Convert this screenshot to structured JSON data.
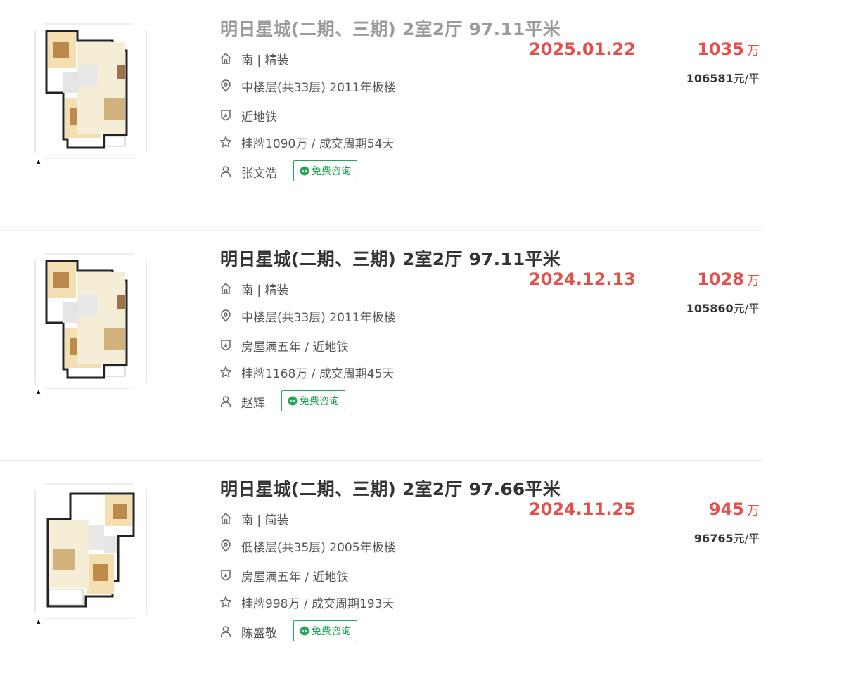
{
  "listings": [
    {
      "title": "明日星城(二期、三期) 2室2厅 97.11平米",
      "visited": true,
      "orientation": "南 | 精装",
      "floor": "中楼层(共33层) 2011年板楼",
      "tags": "近地铁",
      "listing_info": "挂牌1090万 / 成交周期54天",
      "agent": "张文浩",
      "deal_date": "2025.01.22",
      "total_price": "1035",
      "total_unit": "万",
      "unit_price": "106581",
      "unit_price_suffix": "元/平",
      "consult_label": "免费咨询"
    },
    {
      "title": "明日星城(二期、三期) 2室2厅 97.11平米",
      "visited": false,
      "orientation": "南 | 精装",
      "floor": "中楼层(共33层) 2011年板楼",
      "tags": "房屋满五年 / 近地铁",
      "listing_info": "挂牌1168万 / 成交周期45天",
      "agent": "赵辉",
      "deal_date": "2024.12.13",
      "total_price": "1028",
      "total_unit": "万",
      "unit_price": "105860",
      "unit_price_suffix": "元/平",
      "consult_label": "免费咨询"
    },
    {
      "title": "明日星城(二期、三期) 2室2厅 97.66平米",
      "visited": false,
      "orientation": "南 | 简装",
      "floor": "低楼层(共35层) 2005年板楼",
      "tags": "房屋满五年 / 近地铁",
      "listing_info": "挂牌998万 / 成交周期193天",
      "agent": "陈盛敬",
      "deal_date": "2024.11.25",
      "total_price": "945",
      "total_unit": "万",
      "unit_price": "96765",
      "unit_price_suffix": "元/平",
      "consult_label": "免费咨询"
    }
  ],
  "icons": {
    "orientation": "house-icon",
    "floor": "location-pin-icon",
    "tags": "shield-badge-icon",
    "listing_info": "star-icon",
    "agent": "person-icon",
    "consult": "wechat-icon"
  },
  "colors": {
    "price_red": "#e1504b",
    "consult_green": "#26a65b",
    "title_dark": "#333333",
    "title_visited": "#9b9b9b"
  }
}
